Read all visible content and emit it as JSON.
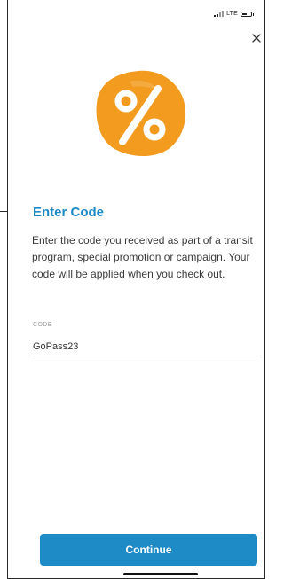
{
  "status_bar": {
    "network": "LTE",
    "signal_icon": "signal-bars-icon",
    "battery_icon": "battery-icon"
  },
  "header": {
    "close_icon": "close-icon"
  },
  "hero": {
    "icon": "percent-badge-icon",
    "color": "#f29b1e"
  },
  "main": {
    "title": "Enter Code",
    "description": "Enter the code you received as part of a transit program, special promotion or campaign. Your code will be applied when you check out."
  },
  "form": {
    "code_label": "CODE",
    "code_value": "GoPass23"
  },
  "footer": {
    "continue_label": "Continue"
  },
  "colors": {
    "accent": "#1e8ac6",
    "promo": "#f29b1e"
  }
}
